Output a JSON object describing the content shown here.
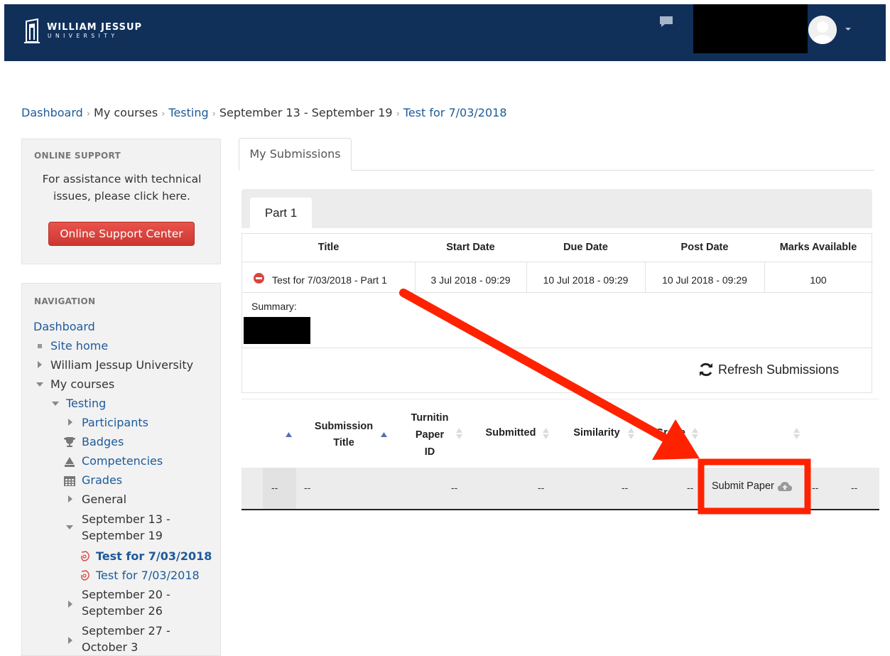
{
  "header": {
    "logo_name": "WILLIAM JESSUP",
    "logo_sub": "UNIVERSITY"
  },
  "breadcrumb": [
    {
      "label": "Dashboard",
      "link": true
    },
    {
      "label": "My courses",
      "link": false
    },
    {
      "label": "Testing",
      "link": true
    },
    {
      "label": "September 13 - September 19",
      "link": false
    },
    {
      "label": "Test for 7/03/2018",
      "link": true
    }
  ],
  "breadcrumb_separator": "›",
  "support": {
    "title": "ONLINE SUPPORT",
    "text_line1": "For assistance with technical",
    "text_line2": "issues, please click here.",
    "button": "Online Support Center"
  },
  "navigation": {
    "title": "NAVIGATION",
    "dashboard": "Dashboard",
    "site_home": "Site home",
    "university": "William Jessup University",
    "my_courses": "My courses",
    "testing": "Testing",
    "participants": "Participants",
    "badges": "Badges",
    "competencies": "Competencies",
    "grades": "Grades",
    "general": "General",
    "week1_line1": "September 13 -",
    "week1_line2": "September 19",
    "test_active": "Test for 7/03/2018",
    "test_other": "Test for 7/03/2018",
    "week2_line1": "September 20 -",
    "week2_line2": "September 26",
    "week3_line1": "September 27 -",
    "week3_line2": "October 3"
  },
  "tabs": {
    "main": "My Submissions",
    "part": "Part 1"
  },
  "assignment": {
    "headers": [
      "Title",
      "Start Date",
      "Due Date",
      "Post Date",
      "Marks Available"
    ],
    "title": "Test for 7/03/2018 - Part 1",
    "start_date": "3 Jul 2018 - 09:29",
    "due_date": "10 Jul 2018 - 09:29",
    "post_date": "10 Jul 2018 - 09:29",
    "marks": "100",
    "summary_label": "Summary:"
  },
  "refresh_label": "Refresh Submissions",
  "submissions": {
    "headers": {
      "submission_title_1": "Submission",
      "submission_title_2": "Title",
      "paper_id_1": "Turnitin",
      "paper_id_2": "Paper",
      "paper_id_3": "ID",
      "submitted": "Submitted",
      "similarity": "Similarity",
      "grade": "Grade"
    },
    "row": {
      "c1": "--",
      "c2": "--",
      "c3": "--",
      "c4": "--",
      "c5": "--",
      "c6": "--",
      "submit": "Submit Paper",
      "c8": "--",
      "c9": "--"
    }
  },
  "colors": {
    "header_bg": "#10305a",
    "link": "#1d5a9a",
    "support_button": "#d9443c",
    "annotation": "#ff2200"
  }
}
